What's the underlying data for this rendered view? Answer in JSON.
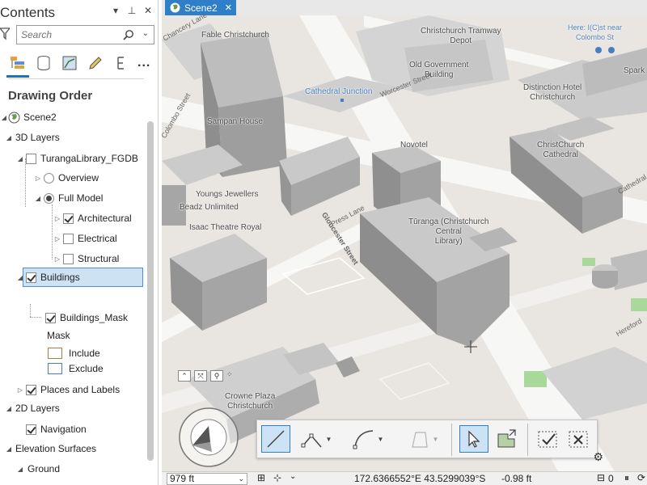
{
  "contents_pane": {
    "title": "Contents",
    "search_placeholder": "Search",
    "drawing_order_label": "Drawing Order",
    "more_label": "...",
    "view_tabs": [
      "drawing-order-icon",
      "data-source-icon",
      "selection-icon",
      "editing-icon",
      "snapping-icon"
    ],
    "tree": {
      "scene": "Scene2",
      "group_3d": "3D Layers",
      "turanga": "TurangaLibrary_FGDB",
      "overview": "Overview",
      "full_model": "Full Model",
      "architectural": "Architectural",
      "electrical": "Electrical",
      "structural": "Structural",
      "buildings": "Buildings",
      "buildings_mask": "Buildings_Mask",
      "mask_heading": "Mask",
      "include": "Include",
      "exclude": "Exclude",
      "places_labels": "Places and Labels",
      "group_2d": "2D Layers",
      "navigation": "Navigation",
      "elevation_surfaces": "Elevation Surfaces",
      "ground": "Ground"
    },
    "swatch_colors": {
      "include": "#b07a45",
      "exclude": "#4a7fbf"
    }
  },
  "scene_view": {
    "tab_label": "Scene2",
    "tab_close": "✕",
    "map_labels": {
      "fable": "Fable Christchurch",
      "tramway": "Christchurch Tramway\nDepot",
      "here": "Here: I(C)st near\nColombo St",
      "old_gov": "Old Government\nBuilding",
      "spark": "Spark",
      "cathedral_junction": "Cathedral Junction",
      "distinction": "Distinction Hotel\nChristchurch",
      "sampan": "Sampan House",
      "novotel": "Novotel",
      "christchurch_cathedral": "ChristChurch\nCathedral",
      "youngs": "Youngs Jewellers",
      "beadz": "Beadz Unlimited",
      "isaac": "Isaac Theatre Royal",
      "turanga": "Tūranga (Christchurch\nCentral\nLibrary)",
      "crowne": "Crowne Plaza\nChristchurch"
    },
    "street_labels": {
      "gloucester": "Gloucester Street",
      "press_lane": "Press Lane",
      "worcester": "Worcester Street",
      "cathedral_sq": "Cathedral Square",
      "hereford": "Hereford",
      "colombo": "Colombo Street",
      "chancery": "Chancery Lane"
    },
    "status": {
      "scale": "979 ft",
      "coordinates": "172.6366552°E 43.5299039°S",
      "elevation": "-0.98 ft",
      "selected_count": "0"
    }
  },
  "colors": {
    "accent": "#2f7fc8",
    "selection_fill": "#cde3f5",
    "building_top": "#c9c9c9",
    "road": "#f6f6f6",
    "park": "#a8d89a"
  }
}
